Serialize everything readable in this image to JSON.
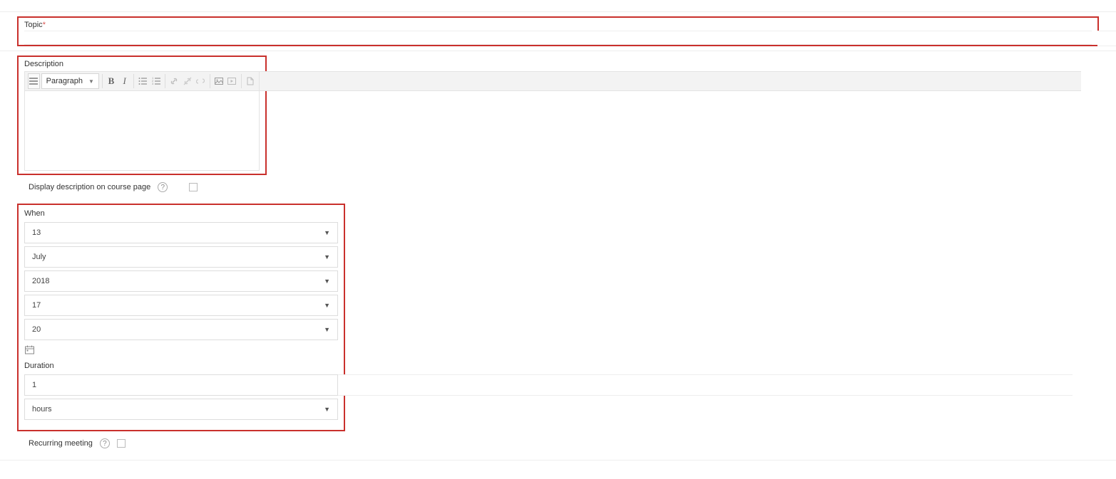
{
  "topic": {
    "label": "Topic",
    "required_marker": "*",
    "value": ""
  },
  "description": {
    "label": "Description",
    "toolbar": {
      "format_selected": "Paragraph"
    }
  },
  "display_on_course": {
    "label": "Display description on course page",
    "checked": false
  },
  "when": {
    "label": "When",
    "day": "13",
    "month": "July",
    "year": "2018",
    "hour": "17",
    "minute": "20"
  },
  "duration": {
    "label": "Duration",
    "value": "1",
    "unit": "hours"
  },
  "recurring": {
    "label": "Recurring meeting",
    "checked": false
  }
}
